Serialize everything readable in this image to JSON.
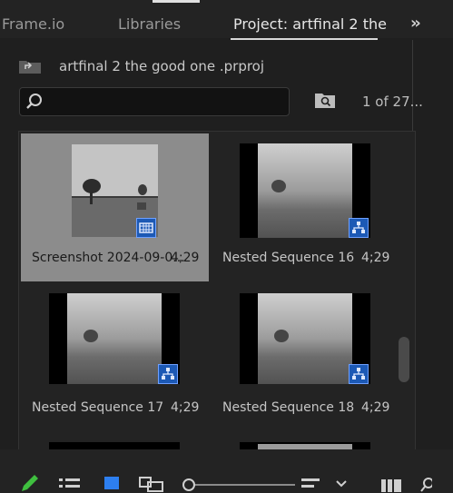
{
  "tabs": [
    {
      "label": "Frame.io",
      "active": false
    },
    {
      "label": "Libraries",
      "active": false
    },
    {
      "label": "Project: artfinal 2 the",
      "active": true
    }
  ],
  "overflow_icon": "double-chevron-right-icon",
  "project_path": "artfinal 2 the good one .prproj",
  "search": {
    "value": "",
    "placeholder": ""
  },
  "item_count": "1 of 27...",
  "items": [
    {
      "name": "Screenshot 2024-09-0...",
      "duration": "4;29",
      "type": "video-clip",
      "selected": true
    },
    {
      "name": "Nested Sequence 16",
      "duration": "4;29",
      "type": "sequence",
      "selected": false
    },
    {
      "name": "Nested Sequence 17",
      "duration": "4;29",
      "type": "sequence",
      "selected": false
    },
    {
      "name": "Nested Sequence 18",
      "duration": "4;29",
      "type": "sequence",
      "selected": false
    }
  ],
  "toolbar_icons": [
    "pencil-icon",
    "list-view-icon",
    "icon-view-icon",
    "freeform-view-icon",
    "zoom-slider",
    "sort-icon",
    "chevron-down-icon",
    "automate-to-sequence-icon",
    "find-icon"
  ],
  "colors": {
    "accent_blue": "#1c59b5",
    "selection_gray": "#8c8c8c",
    "pencil_green": "#3fbf3f"
  }
}
